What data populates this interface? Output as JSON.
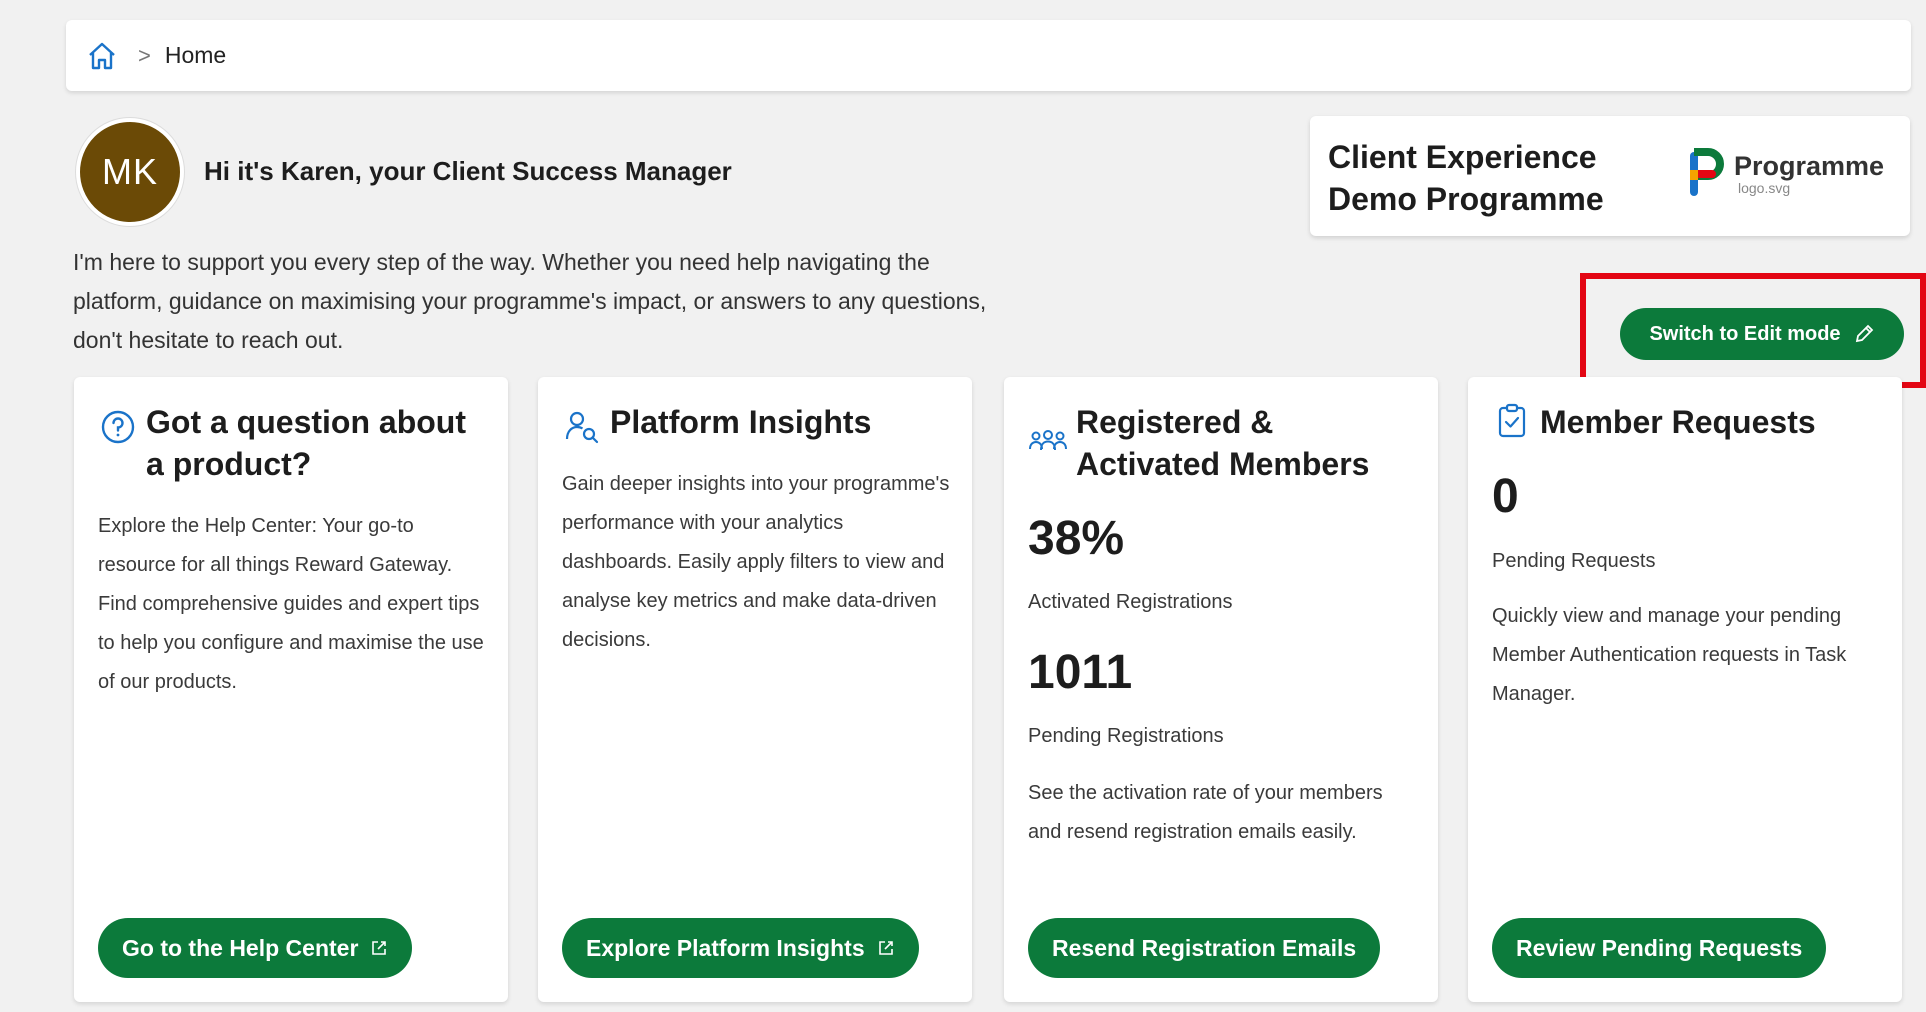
{
  "breadcrumb": {
    "current": "Home",
    "separator": ">"
  },
  "manager": {
    "initials": "MK",
    "greeting": "Hi it's Karen, your Client Success Manager",
    "intro": "I'm here to support you every step of the way. Whether you need help navigating the platform, guidance on maximising your programme's impact, or answers to any questions, don't hesitate to reach out."
  },
  "programme": {
    "name": "Client Experience Demo Programme",
    "logo_word": "Programme",
    "logo_file": "logo.svg"
  },
  "edit_mode": {
    "label": "Switch to Edit mode"
  },
  "cards": {
    "help": {
      "title": "Got a question about a product?",
      "body": "Explore the Help Center: Your go-to resource for all things Reward Gateway. Find comprehensive guides and expert tips to help you configure and maximise the use of our products.",
      "button": "Go to the Help Center"
    },
    "insights": {
      "title": "Platform Insights",
      "body": "Gain deeper insights into your programme's performance with your analytics dashboards. Easily apply filters to view and analyse key metrics and make data-driven decisions.",
      "button": "Explore Platform Insights"
    },
    "members": {
      "title": "Registered & Activated Members",
      "activated_value": "38%",
      "activated_label": "Activated Registrations",
      "pending_value": "1011",
      "pending_label": "Pending Registrations",
      "body": "See the activation rate of your members and resend registration emails easily.",
      "button": "Resend Registration Emails"
    },
    "requests": {
      "title": "Member Requests",
      "pending_value": "0",
      "pending_label": "Pending Requests",
      "body": "Quickly view and manage your pending Member Authentication requests in Task Manager.",
      "button": "Review Pending Requests"
    }
  },
  "colors": {
    "primary_button": "#0c7a3b",
    "icon_blue": "#1a73c9",
    "avatar_bg": "#6b4a06",
    "highlight": "#e30613",
    "page_bg": "#f1f1f1"
  },
  "icons": {
    "home": "home-icon",
    "help": "question-circle-icon",
    "insights": "person-search-icon",
    "members": "people-group-icon",
    "requests": "clipboard-check-icon",
    "edit": "pencil-icon",
    "external": "external-link-icon"
  }
}
